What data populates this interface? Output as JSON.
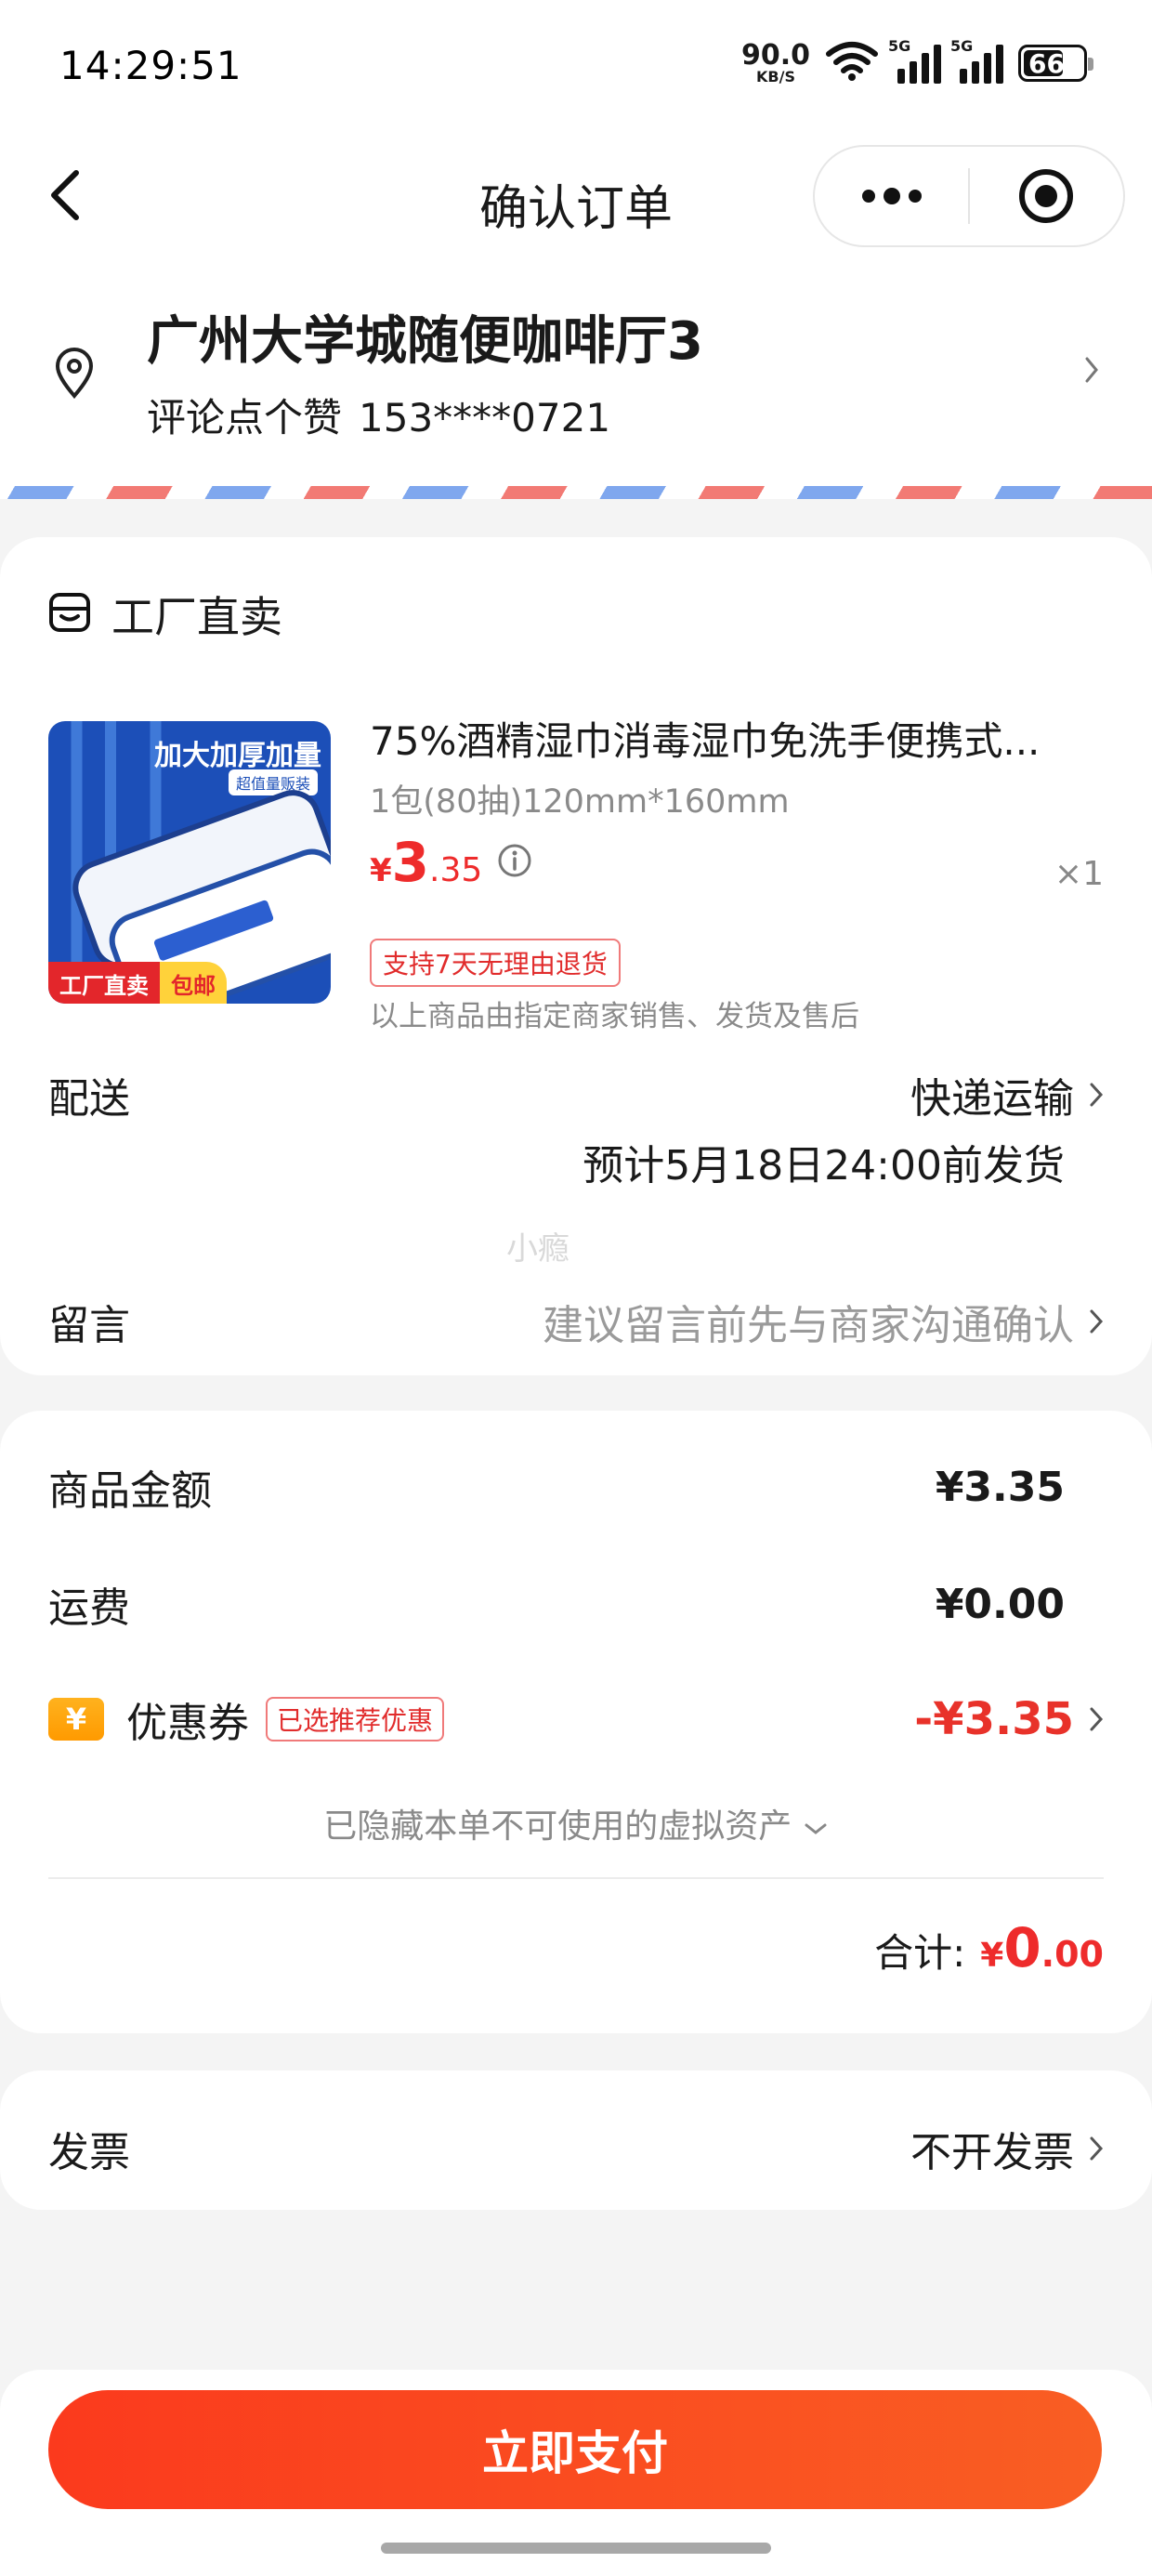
{
  "status_bar": {
    "time": "14:29:51",
    "net_speed": "90.0",
    "net_unit": "KB/S",
    "signal_tag": "5G",
    "battery": "66"
  },
  "nav": {
    "title": "确认订单"
  },
  "address": {
    "title": "广州大学城随便咖啡厅3",
    "name": "评论点个赞",
    "phone": "153****0721"
  },
  "shop": {
    "name": "工厂直卖"
  },
  "product": {
    "title": "75%酒精湿巾消毒湿巾免洗手便携式...",
    "spec": "1包(80抽)120mm*160mm",
    "price_symbol": "¥",
    "price_int": "3",
    "price_dec": ".35",
    "quantity": "×1",
    "return_tag": "支持7天无理由退货",
    "note": "以上商品由指定商家销售、发货及售后",
    "thumb_text": "加大加厚加量",
    "thumb_subtag": "超值量贩装",
    "thumb_badge_a": "工厂直卖",
    "thumb_badge_b": "包邮"
  },
  "delivery": {
    "label": "配送",
    "method": "快递运输",
    "eta": "预计5月18日24:00前发货"
  },
  "watermark": "小瘾",
  "message": {
    "label": "留言",
    "placeholder": "建议留言前先与商家沟通确认"
  },
  "pricing": {
    "goods_label": "商品金额",
    "goods_amount": "¥3.35",
    "shipping_label": "运费",
    "shipping_amount": "¥0.00",
    "coupon_icon": "¥",
    "coupon_label": "优惠券",
    "coupon_tag": "已选推荐优惠",
    "coupon_amount": "-¥3.35",
    "hidden_assets": "已隐藏本单不可使用的虚拟资产",
    "total_label": "合计:",
    "total_symbol": "¥",
    "total_int": "0",
    "total_dec": ".00"
  },
  "invoice": {
    "label": "发票",
    "value": "不开发票"
  },
  "pay_button": "立即支付",
  "colors": {
    "accent": "#ee2b2b",
    "pay_gradient_start": "#fb3a1d",
    "pay_gradient_end": "#f95e23",
    "coupon_icon": "#ff9a00"
  }
}
